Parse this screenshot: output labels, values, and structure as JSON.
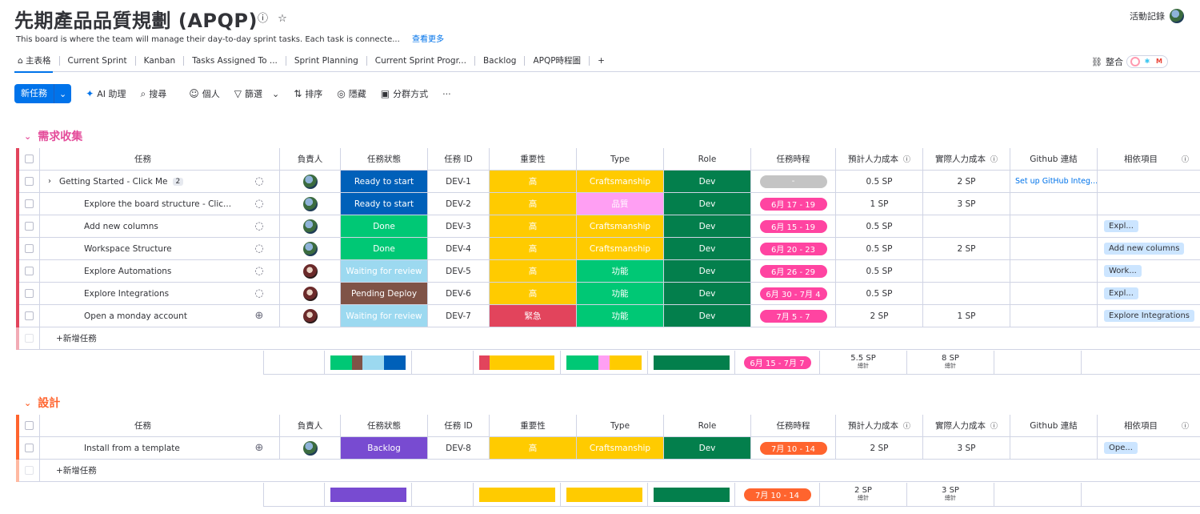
{
  "board": {
    "title": "先期產品品質規劃 (APQP)",
    "description": "This board is where the team will manage their day-to-day sprint tasks. Each task is connecte...",
    "see_more": "查看更多",
    "activity_label": "活動記錄"
  },
  "tabs": [
    "主表格",
    "Current Sprint",
    "Kanban",
    "Tasks Assigned To ...",
    "Sprint Planning",
    "Current Sprint Progr...",
    "Backlog",
    "APQP時程圖",
    "+"
  ],
  "integrate_label": "整合",
  "toolbar": {
    "new_task": "新任務",
    "ai": "AI 助理",
    "search": "搜尋",
    "person": "個人",
    "filter": "篩選",
    "sort": "排序",
    "hide": "隱藏",
    "group_by": "分群方式",
    "more": "···"
  },
  "columns": {
    "task": "任務",
    "owner": "負責人",
    "status": "任務狀態",
    "id": "任務 ID",
    "importance": "重要性",
    "type": "Type",
    "role": "Role",
    "timeline": "任務時程",
    "est": "預計人力成本",
    "actual": "實際人力成本",
    "github": "Github 連結",
    "deps": "相依項目"
  },
  "add_task_label": "+新增任務",
  "total_label": "總計",
  "groups": [
    {
      "name": "需求收集",
      "color": "#e2445c",
      "title_color": "#e44c9a",
      "rows": [
        {
          "task": "Getting Started - Click Me",
          "subitems": "2",
          "update": "chat",
          "owner": "blue",
          "status": "Ready to start",
          "status_color": "#0060b9",
          "id": "DEV-1",
          "importance": "高",
          "importance_color": "#ffcb00",
          "type": "Craftsmanship",
          "type_color": "#ffcb00",
          "role": "Dev",
          "role_color": "#037f4c",
          "timeline": "-",
          "timeline_color": "#c4c4c4",
          "est": "0.5 SP",
          "actual": "2 SP",
          "github": "Set up GitHub Integ...",
          "deps": ""
        },
        {
          "task": "Explore the board structure - Clic...",
          "subitems": "",
          "update": "chat",
          "owner": "blue",
          "status": "Ready to start",
          "status_color": "#0060b9",
          "id": "DEV-2",
          "importance": "高",
          "importance_color": "#ffcb00",
          "type": "品質",
          "type_color": "#ff9ff3",
          "role": "Dev",
          "role_color": "#037f4c",
          "timeline": "6月 17 - 19",
          "timeline_color": "#ff44a1",
          "est": "1 SP",
          "actual": "3 SP",
          "github": "",
          "deps": ""
        },
        {
          "task": "Add new columns",
          "subitems": "",
          "update": "chat",
          "owner": "blue",
          "status": "Done",
          "status_color": "#00c875",
          "id": "DEV-3",
          "importance": "高",
          "importance_color": "#ffcb00",
          "type": "Craftsmanship",
          "type_color": "#ffcb00",
          "role": "Dev",
          "role_color": "#037f4c",
          "timeline": "6月 15 - 19",
          "timeline_color": "#ff44a1",
          "est": "0.5 SP",
          "actual": "",
          "github": "",
          "deps": "Expl..."
        },
        {
          "task": "Workspace Structure",
          "subitems": "",
          "update": "chat",
          "owner": "blue",
          "status": "Done",
          "status_color": "#00c875",
          "id": "DEV-4",
          "importance": "高",
          "importance_color": "#ffcb00",
          "type": "Craftsmanship",
          "type_color": "#ffcb00",
          "role": "Dev",
          "role_color": "#037f4c",
          "timeline": "6月 20 - 23",
          "timeline_color": "#ff44a1",
          "est": "0.5 SP",
          "actual": "2 SP",
          "github": "",
          "deps": "Add new columns"
        },
        {
          "task": "Explore Automations",
          "subitems": "",
          "update": "chat",
          "owner": "red",
          "status": "Waiting for review",
          "status_color": "#9cd9f0",
          "id": "DEV-5",
          "importance": "高",
          "importance_color": "#ffcb00",
          "type": "功能",
          "type_color": "#00c875",
          "role": "Dev",
          "role_color": "#037f4c",
          "timeline": "6月 26 - 29",
          "timeline_color": "#ff44a1",
          "est": "0.5 SP",
          "actual": "",
          "github": "",
          "deps": "Work..."
        },
        {
          "task": "Explore Integrations",
          "subitems": "",
          "update": "chat",
          "owner": "red",
          "status": "Pending Deploy",
          "status_color": "#7f5347",
          "id": "DEV-6",
          "importance": "高",
          "importance_color": "#ffcb00",
          "type": "功能",
          "type_color": "#00c875",
          "role": "Dev",
          "role_color": "#037f4c",
          "timeline": "6月 30 - 7月 4",
          "timeline_color": "#ff44a1",
          "est": "0.5 SP",
          "actual": "",
          "github": "",
          "deps": "Expl..."
        },
        {
          "task": "Open a monday account",
          "subitems": "",
          "update": "add",
          "owner": "red",
          "status": "Waiting for review",
          "status_color": "#9cd9f0",
          "id": "DEV-7",
          "importance": "緊急",
          "importance_color": "#e2445c",
          "type": "功能",
          "type_color": "#00c875",
          "role": "Dev",
          "role_color": "#037f4c",
          "timeline": "7月 5 - 7",
          "timeline_color": "#ff44a1",
          "est": "2 SP",
          "actual": "1 SP",
          "github": "",
          "deps": "Explore Integrations"
        }
      ],
      "summary": {
        "status_bar": [
          {
            "color": "#00c875",
            "share": 0.29
          },
          {
            "color": "#7f5347",
            "share": 0.14
          },
          {
            "color": "#9cd9f0",
            "share": 0.28
          },
          {
            "color": "#0060b9",
            "share": 0.29
          }
        ],
        "importance_bar": [
          {
            "color": "#e2445c",
            "share": 0.14
          },
          {
            "color": "#ffcb00",
            "share": 0.86
          }
        ],
        "type_bar": [
          {
            "color": "#00c875",
            "share": 0.43
          },
          {
            "color": "#ff9ff3",
            "share": 0.14
          },
          {
            "color": "#ffcb00",
            "share": 0.43
          }
        ],
        "role_bar": [
          {
            "color": "#037f4c",
            "share": 1
          }
        ],
        "timeline": "6月 15 - 7月 7",
        "timeline_color": "#ff44a1",
        "est": "5.5 SP",
        "actual": "8 SP"
      }
    },
    {
      "name": "設計",
      "color": "#ff642e",
      "title_color": "#ff642e",
      "rows": [
        {
          "task": "Install from a template",
          "subitems": "",
          "update": "add",
          "owner": "blue",
          "status": "Backlog",
          "status_color": "#784bd1",
          "id": "DEV-8",
          "importance": "高",
          "importance_color": "#ffcb00",
          "type": "Craftsmanship",
          "type_color": "#ffcb00",
          "role": "Dev",
          "role_color": "#037f4c",
          "timeline": "7月 10 - 14",
          "timeline_color": "#ff642e",
          "est": "2 SP",
          "actual": "3 SP",
          "github": "",
          "deps": "Ope..."
        }
      ],
      "summary": {
        "status_bar": [
          {
            "color": "#784bd1",
            "share": 1
          }
        ],
        "importance_bar": [
          {
            "color": "#ffcb00",
            "share": 1
          }
        ],
        "type_bar": [
          {
            "color": "#ffcb00",
            "share": 1
          }
        ],
        "role_bar": [
          {
            "color": "#037f4c",
            "share": 1
          }
        ],
        "timeline": "7月 10 - 14",
        "timeline_color": "#ff642e",
        "est": "2 SP",
        "actual": "3 SP"
      }
    }
  ]
}
